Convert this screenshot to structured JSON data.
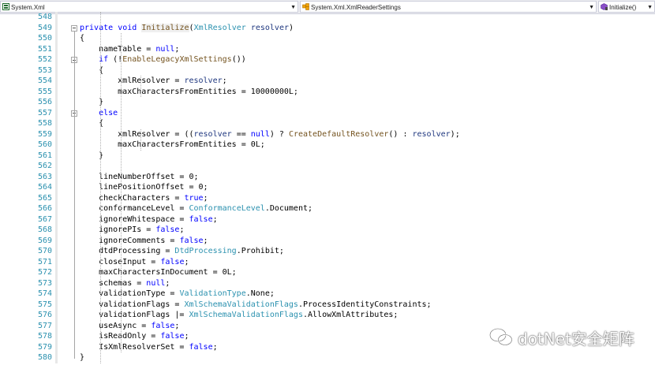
{
  "nav": {
    "project": "System.Xml",
    "type": "System.Xml.XmlReaderSettings",
    "member": "Initialize()"
  },
  "watermark": "dotNet安全矩阵",
  "lines": [
    {
      "n": "548",
      "t": []
    },
    {
      "n": "549",
      "t": [
        [
          "kw",
          "private"
        ],
        [
          "p",
          " "
        ],
        [
          "kw",
          "void"
        ],
        [
          "p",
          " "
        ],
        [
          "fn hl",
          "Initialize"
        ],
        [
          "p",
          "("
        ],
        [
          "ty",
          "XmlResolver"
        ],
        [
          "p",
          " "
        ],
        [
          "prm",
          "resolver"
        ],
        [
          "p",
          ")"
        ]
      ]
    },
    {
      "n": "550",
      "t": [
        [
          "p",
          "{"
        ]
      ]
    },
    {
      "n": "551",
      "t": [
        [
          "p",
          "    nameTable = "
        ],
        [
          "kw",
          "null"
        ],
        [
          "p",
          ";"
        ]
      ]
    },
    {
      "n": "552",
      "t": [
        [
          "p",
          "    "
        ],
        [
          "kw",
          "if"
        ],
        [
          "p",
          " (!"
        ],
        [
          "fn",
          "EnableLegacyXmlSettings"
        ],
        [
          "p",
          "())"
        ]
      ]
    },
    {
      "n": "553",
      "t": [
        [
          "p",
          "    {"
        ]
      ]
    },
    {
      "n": "554",
      "t": [
        [
          "p",
          "        xmlResolver = "
        ],
        [
          "prm",
          "resolver"
        ],
        [
          "p",
          ";"
        ]
      ]
    },
    {
      "n": "555",
      "t": [
        [
          "p",
          "        maxCharactersFromEntities = 10000000L;"
        ]
      ]
    },
    {
      "n": "556",
      "t": [
        [
          "p",
          "    }"
        ]
      ]
    },
    {
      "n": "557",
      "t": [
        [
          "p",
          "    "
        ],
        [
          "kw",
          "else"
        ]
      ]
    },
    {
      "n": "558",
      "t": [
        [
          "p",
          "    {"
        ]
      ]
    },
    {
      "n": "559",
      "t": [
        [
          "p",
          "        xmlResolver = (("
        ],
        [
          "prm",
          "resolver"
        ],
        [
          "p",
          " == "
        ],
        [
          "kw",
          "null"
        ],
        [
          "p",
          ") ? "
        ],
        [
          "fn",
          "CreateDefaultResolver"
        ],
        [
          "p",
          "() : "
        ],
        [
          "prm",
          "resolver"
        ],
        [
          "p",
          ");"
        ]
      ]
    },
    {
      "n": "560",
      "t": [
        [
          "p",
          "        maxCharactersFromEntities = 0L;"
        ]
      ]
    },
    {
      "n": "561",
      "t": [
        [
          "p",
          "    }"
        ]
      ]
    },
    {
      "n": "562",
      "t": []
    },
    {
      "n": "563",
      "t": [
        [
          "p",
          "    lineNumberOffset = 0;"
        ]
      ]
    },
    {
      "n": "564",
      "t": [
        [
          "p",
          "    linePositionOffset = 0;"
        ]
      ]
    },
    {
      "n": "565",
      "t": [
        [
          "p",
          "    checkCharacters = "
        ],
        [
          "kw",
          "true"
        ],
        [
          "p",
          ";"
        ]
      ]
    },
    {
      "n": "566",
      "t": [
        [
          "p",
          "    conformanceLevel = "
        ],
        [
          "ty",
          "ConformanceLevel"
        ],
        [
          "p",
          ".Document;"
        ]
      ]
    },
    {
      "n": "567",
      "t": [
        [
          "p",
          "    ignoreWhitespace = "
        ],
        [
          "kw",
          "false"
        ],
        [
          "p",
          ";"
        ]
      ]
    },
    {
      "n": "568",
      "t": [
        [
          "p",
          "    ignorePIs = "
        ],
        [
          "kw",
          "false"
        ],
        [
          "p",
          ";"
        ]
      ]
    },
    {
      "n": "569",
      "t": [
        [
          "p",
          "    ignoreComments = "
        ],
        [
          "kw",
          "false"
        ],
        [
          "p",
          ";"
        ]
      ]
    },
    {
      "n": "570",
      "t": [
        [
          "p",
          "    dtdProcessing = "
        ],
        [
          "ty",
          "DtdProcessing"
        ],
        [
          "p",
          ".Prohibit;"
        ]
      ]
    },
    {
      "n": "571",
      "t": [
        [
          "p",
          "    closeInput = "
        ],
        [
          "kw",
          "false"
        ],
        [
          "p",
          ";"
        ]
      ]
    },
    {
      "n": "572",
      "t": [
        [
          "p",
          "    maxCharactersInDocument = 0L;"
        ]
      ]
    },
    {
      "n": "573",
      "t": [
        [
          "p",
          "    schemas = "
        ],
        [
          "kw",
          "null"
        ],
        [
          "p",
          ";"
        ]
      ]
    },
    {
      "n": "574",
      "t": [
        [
          "p",
          "    validationType = "
        ],
        [
          "ty",
          "ValidationType"
        ],
        [
          "p",
          ".None;"
        ]
      ]
    },
    {
      "n": "575",
      "t": [
        [
          "p",
          "    validationFlags = "
        ],
        [
          "ty",
          "XmlSchemaValidationFlags"
        ],
        [
          "p",
          ".ProcessIdentityConstraints;"
        ]
      ]
    },
    {
      "n": "576",
      "t": [
        [
          "p",
          "    validationFlags |= "
        ],
        [
          "ty",
          "XmlSchemaValidationFlags"
        ],
        [
          "p",
          ".AllowXmlAttributes;"
        ]
      ]
    },
    {
      "n": "577",
      "t": [
        [
          "p",
          "    useAsync = "
        ],
        [
          "kw",
          "false"
        ],
        [
          "p",
          ";"
        ]
      ]
    },
    {
      "n": "578",
      "t": [
        [
          "p",
          "    isReadOnly = "
        ],
        [
          "kw",
          "false"
        ],
        [
          "p",
          ";"
        ]
      ]
    },
    {
      "n": "579",
      "t": [
        [
          "p",
          "    IsXmlResolverSet = "
        ],
        [
          "kw",
          "false"
        ],
        [
          "p",
          ";"
        ]
      ]
    },
    {
      "n": "580",
      "t": [
        [
          "p",
          "}"
        ]
      ]
    }
  ],
  "fold_lines": [
    "549",
    "552",
    "557"
  ]
}
